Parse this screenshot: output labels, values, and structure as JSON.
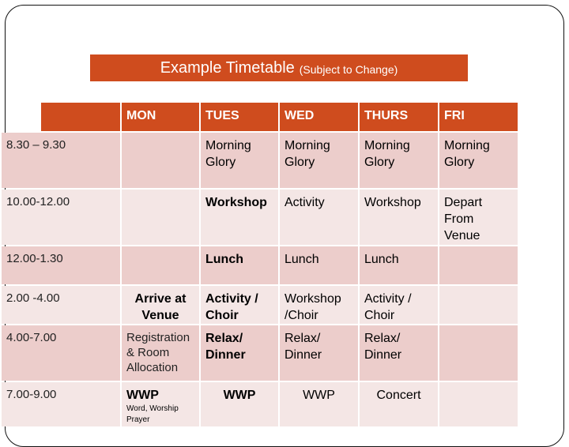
{
  "title": {
    "main": "Example Timetable",
    "sub": "(Subject to Change)"
  },
  "colors": {
    "header": "#cf4c1e",
    "row_dark": "#eccdcb",
    "row_light": "#f4e6e5"
  },
  "table": {
    "headers": [
      "",
      "MON",
      "TUES",
      "WED",
      "THURS",
      "FRI"
    ],
    "rows": [
      {
        "time": "8.30 – 9.30",
        "mon": "",
        "tues": "Morning Glory",
        "wed": "Morning Glory",
        "thurs": "Morning Glory",
        "fri": "Morning Glory"
      },
      {
        "time": "10.00-12.00",
        "mon": "",
        "tues": "Workshop",
        "wed": "Activity",
        "thurs": "Workshop",
        "fri": "Depart From Venue"
      },
      {
        "time": "12.00-1.30",
        "mon": "",
        "tues": "Lunch",
        "wed": "Lunch",
        "thurs": "Lunch",
        "fri": ""
      },
      {
        "time": "2.00 -4.00",
        "mon": "Arrive at Venue",
        "tues": "Activity / Choir",
        "wed": "Workshop /Choir",
        "thurs": "Activity / Choir",
        "fri": ""
      },
      {
        "time": "4.00-7.00",
        "mon": "Registration & Room Allocation",
        "tues": "Relax/ Dinner",
        "wed": "Relax/ Dinner",
        "thurs": "Relax/ Dinner",
        "fri": ""
      },
      {
        "time": "7.00-9.00",
        "mon": "WWP",
        "mon_note": "Word, Worship Prayer",
        "tues": "WWP",
        "wed": "WWP",
        "thurs": "Concert",
        "fri": ""
      }
    ]
  }
}
